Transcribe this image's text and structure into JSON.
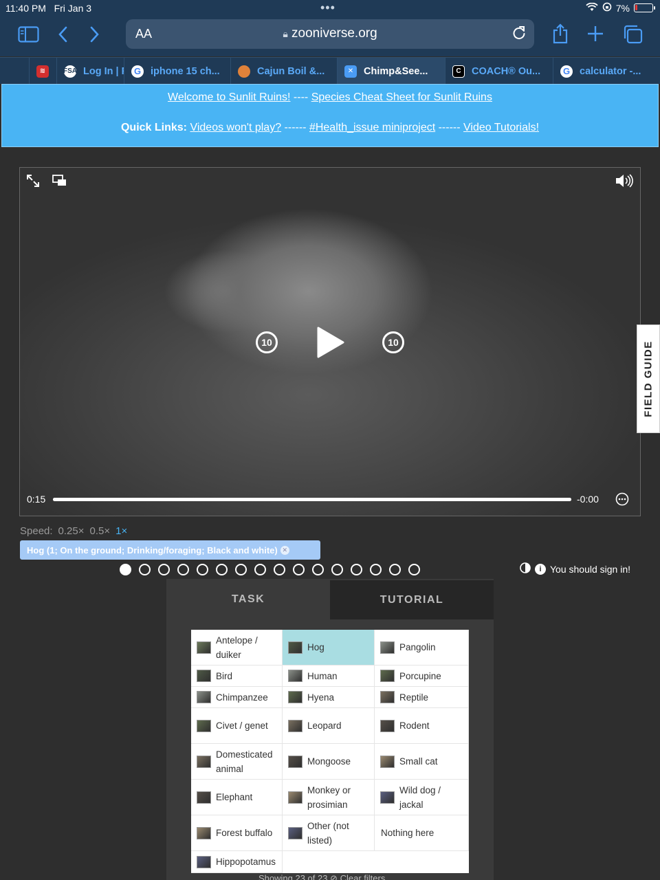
{
  "status": {
    "time": "11:40 PM",
    "date": "Fri Jan 3",
    "battery": "7%"
  },
  "browser": {
    "text_size": "AA",
    "domain": "zooniverse.org"
  },
  "tabs": [
    {
      "label": "",
      "favicon": "#d32f2f"
    },
    {
      "label": "Log In | F",
      "favicon": "#ffffff"
    },
    {
      "label": "iphone 15 ch...",
      "favicon": "#ffffff"
    },
    {
      "label": "Cajun Boil &...",
      "favicon": "#e0823a"
    },
    {
      "label": "Chimp&See...",
      "favicon": "#4a9cf5",
      "active": true
    },
    {
      "label": "COACH® Ou...",
      "favicon": "#000000"
    },
    {
      "label": "calculator -...",
      "favicon": "#ffffff"
    }
  ],
  "banner": {
    "welcome": "Welcome to Sunlit Ruins!",
    "sep1": " ---- ",
    "cheat_sheet": "Species Cheat Sheet for Sunlit Ruins",
    "quick_links_label": "Quick Links:",
    "link1": "Videos won't play?",
    "sep2": " ------ ",
    "link2": "#Health_issue miniproject",
    "sep3": " ------ ",
    "link3": "Video Tutorials!"
  },
  "video": {
    "current_time": "0:15",
    "remaining": "-0:00",
    "skip_back": "10",
    "skip_forward": "10",
    "progress": 1.0
  },
  "field_guide": "FIELD GUIDE",
  "speed": {
    "label": "Speed:",
    "options": [
      "0.25×",
      "0.5×",
      "1×"
    ],
    "selected": "1×"
  },
  "annotation": "Hog (1; On the ground; Drinking/foraging; Black and white)",
  "pager": {
    "total": 16,
    "current": 1
  },
  "signin": "You should sign in!",
  "panel": {
    "tab_task": "TASK",
    "tab_tutorial": "TUTORIAL"
  },
  "species": [
    [
      "Antelope / duiker",
      "Hog",
      "Pangolin"
    ],
    [
      "Bird",
      "Human",
      "Porcupine"
    ],
    [
      "Chimpanzee",
      "Hyena",
      "Reptile"
    ],
    [
      "Civet / genet",
      "Leopard",
      "Rodent"
    ],
    [
      "Domesticated animal",
      "Mongoose",
      "Small cat"
    ],
    [
      "Elephant",
      "Monkey or prosimian",
      "Wild dog / jackal"
    ],
    [
      "Forest buffalo",
      "Other (not listed)",
      "Nothing here"
    ],
    [
      "Hippopotamus",
      "",
      ""
    ]
  ],
  "selected_species": "Hog",
  "footer": "Showing 23 of 23  ⊘ Clear filters"
}
